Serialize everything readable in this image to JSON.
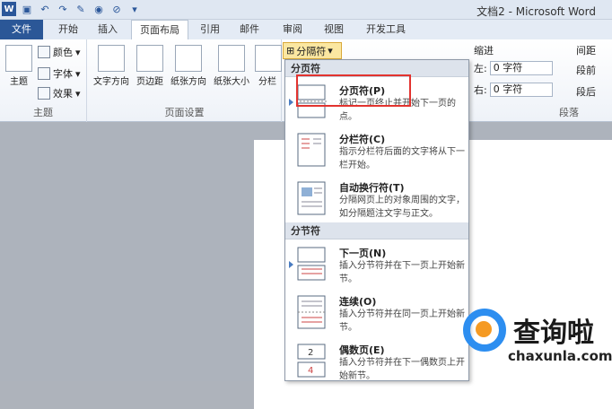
{
  "window": {
    "title": "文档2 - Microsoft Word"
  },
  "qat": {
    "word_logo": "W"
  },
  "tabs": [
    "文件",
    "开始",
    "插入",
    "页面布局",
    "引用",
    "邮件",
    "审阅",
    "视图",
    "开发工具"
  ],
  "ribbon": {
    "theme_group": {
      "label": "主题",
      "theme_btn": "主题",
      "colors": "颜色",
      "fonts": "字体",
      "effects": "效果"
    },
    "page_setup_group": {
      "label": "页面设置",
      "text_direction": "文字方向",
      "margins": "页边距",
      "orientation": "纸张方向",
      "size": "纸张大小",
      "columns": "分栏"
    },
    "breaks_btn": "分隔符",
    "indent": {
      "label": "缩进",
      "left_label": "左:",
      "left_value": "0 字符",
      "right_label": "右:",
      "right_value": "0 字符"
    },
    "spacing": {
      "label": "间距",
      "before_label": "段前",
      "after_label": "段后"
    },
    "paragraph_group": {
      "label": "段落"
    }
  },
  "dropdown": {
    "section_page": "分页符",
    "section_section": "分节符",
    "items": [
      {
        "title": "分页符(P)",
        "desc": "标记一页终止并开始下一页的点。"
      },
      {
        "title": "分栏符(C)",
        "desc": "指示分栏符后面的文字将从下一栏开始。"
      },
      {
        "title": "自动换行符(T)",
        "desc": "分隔网页上的对象周围的文字，如分隔题注文字与正文。"
      },
      {
        "title": "下一页(N)",
        "desc": "插入分节符并在下一页上开始新节。"
      },
      {
        "title": "连续(O)",
        "desc": "插入分节符并在同一页上开始新节。"
      },
      {
        "title": "偶数页(E)",
        "desc": "插入分节符并在下一偶数页上开始新节。"
      }
    ]
  },
  "watermark": {
    "brand": "查询啦",
    "url": "chaxunla.com"
  },
  "colors": {
    "file_tab": "#2b5797",
    "highlight": "#e2332f",
    "breaks_btn_bg": "#fbe7a1"
  }
}
